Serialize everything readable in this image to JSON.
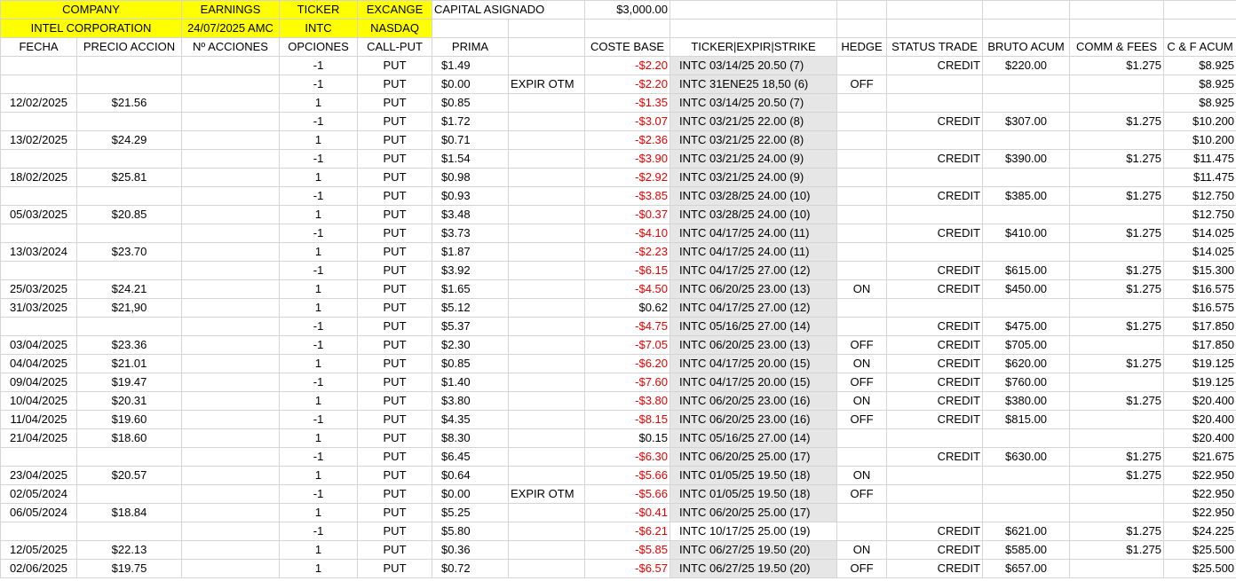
{
  "header": {
    "company_label": "COMPANY",
    "company_name": "INTEL CORPORATION",
    "earnings_label": "EARNINGS",
    "earnings_value": "24/07/2025 AMC",
    "ticker_label": "TICKER",
    "ticker_value": "INTC",
    "exchange_label": "EXCANGE",
    "exchange_value": "NASDAQ",
    "capital_label": "CAPITAL ASIGNADO",
    "capital_value": "$3,000.00"
  },
  "columns": [
    "FECHA",
    "PRECIO ACCION",
    "Nº ACCIONES",
    "OPCIONES",
    "CALL-PUT",
    "PRIMA",
    "",
    "COSTE BASE",
    "TICKER|EXPIR|STRIKE",
    "HEDGE",
    "STATUS TRADE",
    "BRUTO ACUM",
    "COMM & FEES",
    "C & F ACUM"
  ],
  "colors": {
    "header_yellow": "#ffff00",
    "negative_red": "#e60000",
    "ticker_grey": "#e6e6e6"
  },
  "rows": [
    {
      "fecha": "",
      "precio": "",
      "acciones": "",
      "opciones": "-1",
      "cp": "PUT",
      "prima": "$1.49",
      "nota": "",
      "coste": "-$2.20",
      "neg": true,
      "ticker": "INTC  03/14/25  20.50 (7)",
      "grey": true,
      "hedge": "",
      "status": "CREDIT",
      "bruto": "$220.00",
      "comm": "$1.275",
      "cf": "$8.925"
    },
    {
      "fecha": "",
      "precio": "",
      "acciones": "",
      "opciones": "-1",
      "cp": "PUT",
      "prima": "$0.00",
      "nota": "EXPIR OTM",
      "coste": "-$2.20",
      "neg": true,
      "ticker": "INTC  31ENE25  18,50 (6)",
      "grey": true,
      "hedge": "OFF",
      "status": "",
      "bruto": "",
      "comm": "",
      "cf": "$8.925"
    },
    {
      "fecha": "12/02/2025",
      "precio": "$21.56",
      "acciones": "",
      "opciones": "1",
      "cp": "PUT",
      "prima": "$0.85",
      "nota": "",
      "coste": "-$1.35",
      "neg": true,
      "ticker": "INTC  03/14/25  20.50 (7)",
      "grey": true,
      "hedge": "",
      "status": "",
      "bruto": "",
      "comm": "",
      "cf": "$8.925"
    },
    {
      "fecha": "",
      "precio": "",
      "acciones": "",
      "opciones": "-1",
      "cp": "PUT",
      "prima": "$1.72",
      "nota": "",
      "coste": "-$3.07",
      "neg": true,
      "ticker": "INTC  03/21/25   22.00 (8)",
      "grey": true,
      "hedge": "",
      "status": "CREDIT",
      "bruto": "$307.00",
      "comm": "$1.275",
      "cf": "$10.200"
    },
    {
      "fecha": "13/02/2025",
      "precio": "$24.29",
      "acciones": "",
      "opciones": "1",
      "cp": "PUT",
      "prima": "$0.71",
      "nota": "",
      "coste": "-$2.36",
      "neg": true,
      "ticker": "INTC  03/21/25   22.00 (8)",
      "grey": true,
      "hedge": "",
      "status": "",
      "bruto": "",
      "comm": "",
      "cf": "$10.200"
    },
    {
      "fecha": "",
      "precio": "",
      "acciones": "",
      "opciones": "-1",
      "cp": "PUT",
      "prima": "$1.54",
      "nota": "",
      "coste": "-$3.90",
      "neg": true,
      "ticker": "INTC  03/21/25   24.00 (9)",
      "grey": true,
      "hedge": "",
      "status": "CREDIT",
      "bruto": "$390.00",
      "comm": "$1.275",
      "cf": "$11.475"
    },
    {
      "fecha": "18/02/2025",
      "precio": "$25.81",
      "acciones": "",
      "opciones": "1",
      "cp": "PUT",
      "prima": "$0.98",
      "nota": "",
      "coste": "-$2.92",
      "neg": true,
      "ticker": "INTC  03/21/25   24.00 (9)",
      "grey": true,
      "hedge": "",
      "status": "",
      "bruto": "",
      "comm": "",
      "cf": "$11.475"
    },
    {
      "fecha": "",
      "precio": "",
      "acciones": "",
      "opciones": "-1",
      "cp": "PUT",
      "prima": "$0.93",
      "nota": "",
      "coste": "-$3.85",
      "neg": true,
      "ticker": "INTC  03/28/25   24.00 (10)",
      "grey": true,
      "hedge": "",
      "status": "CREDIT",
      "bruto": "$385.00",
      "comm": "$1.275",
      "cf": "$12.750"
    },
    {
      "fecha": "05/03/2025",
      "precio": "$20.85",
      "acciones": "",
      "opciones": "1",
      "cp": "PUT",
      "prima": "$3.48",
      "nota": "",
      "coste": "-$0.37",
      "neg": true,
      "ticker": "INTC  03/28/25   24.00 (10)",
      "grey": true,
      "hedge": "",
      "status": "",
      "bruto": "",
      "comm": "",
      "cf": "$12.750"
    },
    {
      "fecha": "",
      "precio": "",
      "acciones": "",
      "opciones": "-1",
      "cp": "PUT",
      "prima": "$3.73",
      "nota": "",
      "coste": "-$4.10",
      "neg": true,
      "ticker": "INTC  04/17/25   24.00 (11)",
      "grey": true,
      "hedge": "",
      "status": "CREDIT",
      "bruto": "$410.00",
      "comm": "$1.275",
      "cf": "$14.025"
    },
    {
      "fecha": "13/03/2024",
      "precio": "$23.70",
      "acciones": "",
      "opciones": "1",
      "cp": "PUT",
      "prima": "$1.87",
      "nota": "",
      "coste": "-$2.23",
      "neg": true,
      "ticker": "INTC  04/17/25   24.00 (11)",
      "grey": true,
      "hedge": "",
      "status": "",
      "bruto": "",
      "comm": "",
      "cf": "$14.025"
    },
    {
      "fecha": "",
      "precio": "",
      "acciones": "",
      "opciones": "-1",
      "cp": "PUT",
      "prima": "$3.92",
      "nota": "",
      "coste": "-$6.15",
      "neg": true,
      "ticker": "INTC  04/17/25   27.00 (12)",
      "grey": true,
      "hedge": "",
      "status": "CREDIT",
      "bruto": "$615.00",
      "comm": "$1.275",
      "cf": "$15.300"
    },
    {
      "fecha": "25/03/2025",
      "precio": "$24.21",
      "acciones": "",
      "opciones": "1",
      "cp": "PUT",
      "prima": "$1.65",
      "nota": "",
      "coste": "-$4.50",
      "neg": true,
      "ticker": "INTC  06/20/25   23.00 (13)",
      "grey": true,
      "hedge": "ON",
      "status": "CREDIT",
      "bruto": "$450.00",
      "comm": "$1.275",
      "cf": "$16.575"
    },
    {
      "fecha": "31/03/2025",
      "precio": "$21,90",
      "acciones": "",
      "opciones": "1",
      "cp": "PUT",
      "prima": "$5.12",
      "nota": "",
      "coste": "$0.62",
      "neg": false,
      "ticker": "INTC  04/17/25   27.00 (12)",
      "grey": true,
      "hedge": "",
      "status": "",
      "bruto": "",
      "comm": "",
      "cf": "$16.575"
    },
    {
      "fecha": "",
      "precio": "",
      "acciones": "",
      "opciones": "-1",
      "cp": "PUT",
      "prima": "$5.37",
      "nota": "",
      "coste": "-$4.75",
      "neg": true,
      "ticker": "INTC  05/16/25   27.00 (14)",
      "grey": true,
      "hedge": "",
      "status": "CREDIT",
      "bruto": "$475.00",
      "comm": "$1.275",
      "cf": "$17.850"
    },
    {
      "fecha": "03/04/2025",
      "precio": "$23.36",
      "acciones": "",
      "opciones": "-1",
      "cp": "PUT",
      "prima": "$2.30",
      "nota": "",
      "coste": "-$7.05",
      "neg": true,
      "ticker": "INTC  06/20/25   23.00 (13)",
      "grey": true,
      "hedge": "OFF",
      "status": "CREDIT",
      "bruto": "$705.00",
      "comm": "",
      "cf": "$17.850"
    },
    {
      "fecha": "04/04/2025",
      "precio": "$21.01",
      "acciones": "",
      "opciones": "1",
      "cp": "PUT",
      "prima": "$0.85",
      "nota": "",
      "coste": "-$6.20",
      "neg": true,
      "ticker": "INTC  04/17/25   20.00 (15)",
      "grey": true,
      "hedge": "ON",
      "status": "CREDIT",
      "bruto": "$620.00",
      "comm": "$1.275",
      "cf": "$19.125"
    },
    {
      "fecha": "09/04/2025",
      "precio": "$19.47",
      "acciones": "",
      "opciones": "-1",
      "cp": "PUT",
      "prima": "$1.40",
      "nota": "",
      "coste": "-$7.60",
      "neg": true,
      "ticker": "INTC  04/17/25   20.00 (15)",
      "grey": true,
      "hedge": "OFF",
      "status": "CREDIT",
      "bruto": "$760.00",
      "comm": "",
      "cf": "$19.125"
    },
    {
      "fecha": "10/04/2025",
      "precio": "$20.31",
      "acciones": "",
      "opciones": "1",
      "cp": "PUT",
      "prima": "$3.80",
      "nota": "",
      "coste": "-$3.80",
      "neg": true,
      "ticker": "INTC  06/20/25   23.00 (16)",
      "grey": true,
      "hedge": "ON",
      "status": "CREDIT",
      "bruto": "$380.00",
      "comm": "$1.275",
      "cf": "$20.400"
    },
    {
      "fecha": "11/04/2025",
      "precio": "$19.60",
      "acciones": "",
      "opciones": "-1",
      "cp": "PUT",
      "prima": "$4.35",
      "nota": "",
      "coste": "-$8.15",
      "neg": true,
      "ticker": "INTC  06/20/25   23.00 (16)",
      "grey": true,
      "hedge": "OFF",
      "status": "CREDIT",
      "bruto": "$815.00",
      "comm": "",
      "cf": "$20.400"
    },
    {
      "fecha": "21/04/2025",
      "precio": "$18.60",
      "acciones": "",
      "opciones": "1",
      "cp": "PUT",
      "prima": "$8.30",
      "nota": "",
      "coste": "$0.15",
      "neg": false,
      "ticker": "INTC  05/16/25   27.00 (14)",
      "grey": true,
      "hedge": "",
      "status": "",
      "bruto": "",
      "comm": "",
      "cf": "$20.400"
    },
    {
      "fecha": "",
      "precio": "",
      "acciones": "",
      "opciones": "-1",
      "cp": "PUT",
      "prima": "$6.45",
      "nota": "",
      "coste": "-$6.30",
      "neg": true,
      "ticker": "INTC  06/20/25   25.00 (17)",
      "grey": true,
      "hedge": "",
      "status": "CREDIT",
      "bruto": "$630.00",
      "comm": "$1.275",
      "cf": "$21.675"
    },
    {
      "fecha": "23/04/2025",
      "precio": "$20.57",
      "acciones": "",
      "opciones": "1",
      "cp": "PUT",
      "prima": "$0.64",
      "nota": "",
      "coste": "-$5.66",
      "neg": true,
      "ticker": "INTC  01/05/25   19.50 (18)",
      "grey": true,
      "hedge": "ON",
      "status": "",
      "bruto": "",
      "comm": "$1.275",
      "cf": "$22.950"
    },
    {
      "fecha": "02/05/2024",
      "precio": "",
      "acciones": "",
      "opciones": "-1",
      "cp": "PUT",
      "prima": "$0.00",
      "nota": "EXPIR OTM",
      "coste": "-$5.66",
      "neg": true,
      "ticker": "INTC  01/05/25   19.50 (18)",
      "grey": true,
      "hedge": "OFF",
      "status": "",
      "bruto": "",
      "comm": "",
      "cf": "$22.950"
    },
    {
      "fecha": "06/05/2024",
      "precio": "$18.84",
      "acciones": "",
      "opciones": "1",
      "cp": "PUT",
      "prima": "$5.25",
      "nota": "",
      "coste": "-$0.41",
      "neg": true,
      "ticker": "INTC  06/20/25   25.00 (17)",
      "grey": true,
      "hedge": "",
      "status": "",
      "bruto": "",
      "comm": "",
      "cf": "$22.950"
    },
    {
      "fecha": "",
      "precio": "",
      "acciones": "",
      "opciones": "-1",
      "cp": "PUT",
      "prima": "$5.80",
      "nota": "",
      "coste": "-$6.21",
      "neg": true,
      "ticker": "INTC  10/17/25   25.00 (19)",
      "grey": false,
      "hedge": "",
      "status": "CREDIT",
      "bruto": "$621.00",
      "comm": "$1.275",
      "cf": "$24.225"
    },
    {
      "fecha": "12/05/2025",
      "precio": "$22.13",
      "acciones": "",
      "opciones": "1",
      "cp": "PUT",
      "prima": "$0.36",
      "nota": "",
      "coste": "-$5.85",
      "neg": true,
      "ticker": "INTC  06/27/25   19.50 (20)",
      "grey": true,
      "hedge": "ON",
      "status": "CREDIT",
      "bruto": "$585.00",
      "comm": "$1.275",
      "cf": "$25.500"
    },
    {
      "fecha": "02/06/2025",
      "precio": "$19.75",
      "acciones": "",
      "opciones": "1",
      "cp": "PUT",
      "prima": "$0.72",
      "nota": "",
      "coste": "-$6.57",
      "neg": true,
      "ticker": "INTC  06/27/25   19.50 (20)",
      "grey": true,
      "hedge": "OFF",
      "status": "CREDIT",
      "bruto": "$657.00",
      "comm": "",
      "cf": "$25.500"
    }
  ]
}
